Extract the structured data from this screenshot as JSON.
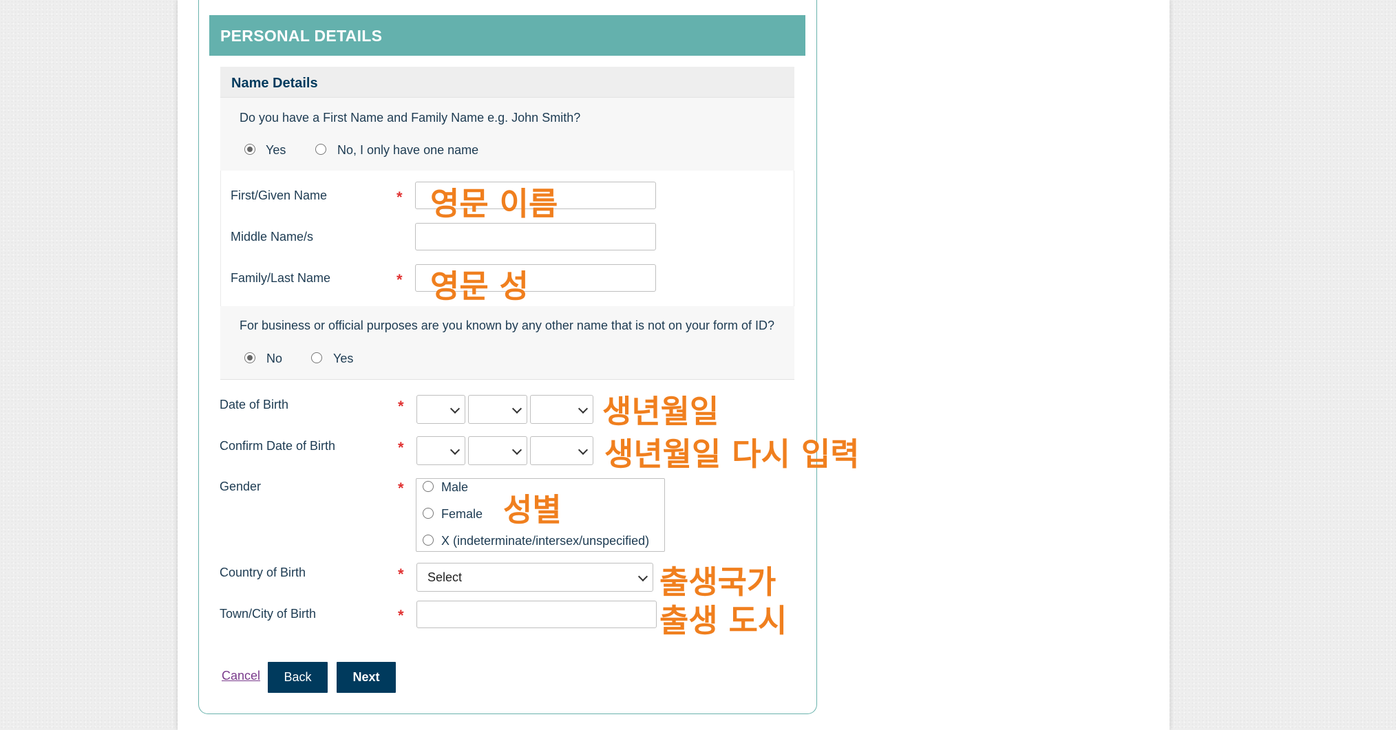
{
  "section": {
    "title": "PERSONAL DETAILS"
  },
  "name_details": {
    "heading": "Name Details",
    "question": "Do you have a First Name and Family Name e.g. John Smith?",
    "options": [
      "Yes",
      "No, I only have one name"
    ],
    "selected": "Yes"
  },
  "fields": {
    "first_name_label": "First/Given Name",
    "middle_name_label": "Middle Name/s",
    "last_name_label": "Family/Last Name",
    "first_name_value": "",
    "middle_name_value": "",
    "last_name_value": ""
  },
  "other_name": {
    "question": "For business or official purposes are you known by any other name that is not on your form of ID?",
    "options": [
      "No",
      "Yes"
    ],
    "selected": "No"
  },
  "dob": {
    "label": "Date of Birth",
    "confirm_label": "Confirm Date of Birth"
  },
  "gender": {
    "label": "Gender",
    "options": [
      "Male",
      "Female",
      "X (indeterminate/intersex/unspecified)"
    ]
  },
  "country_of_birth": {
    "label": "Country of Birth",
    "value": "Select"
  },
  "town_of_birth": {
    "label": "Town/City of Birth",
    "value": ""
  },
  "required_marker": "*",
  "annotations": {
    "first_name": "영문 이름",
    "last_name": "영문 성",
    "dob": "생년월일",
    "dob_confirm": "생년월일 다시 입력",
    "gender": "성별",
    "country": "출생국가",
    "town": "출생 도시"
  },
  "actions": {
    "cancel": "Cancel",
    "back": "Back",
    "next": "Next"
  },
  "colors": {
    "header_bg": "#64b1ad",
    "primary_button": "#003a5d",
    "annotation": "#f07f1e",
    "required": "#e03131"
  }
}
